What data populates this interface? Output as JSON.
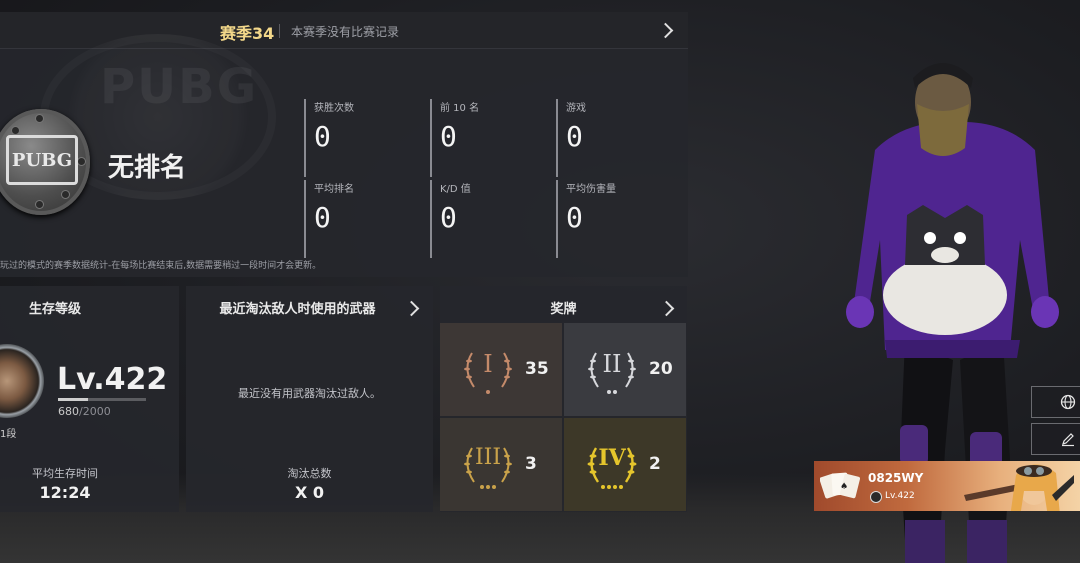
{
  "season": {
    "title": "赛季34",
    "note": "本赛季没有比赛记录",
    "rank_name": "无排名",
    "badge_text": "PUBG",
    "bg_logo_text": "PUBG",
    "stats": [
      {
        "label": "获胜次数",
        "value": "0"
      },
      {
        "label": "前 10 名",
        "value": "0"
      },
      {
        "label": "游戏",
        "value": "0"
      },
      {
        "label": "平均排名",
        "value": "0"
      },
      {
        "label": "K/D 值",
        "value": "0"
      },
      {
        "label": "平均伤害量",
        "value": "0"
      }
    ],
    "footnote": "玩过的模式的赛季数据统计-在每场比赛结束后,数据需要稍过一段时间才会更新。"
  },
  "survival": {
    "title": "生存等级",
    "level": "Lv.422",
    "xp_current": "680",
    "xp_total": "/2000",
    "xp_fraction": 0.34,
    "tier": "1段",
    "avg_time_label": "平均生存时间",
    "avg_time_value": "12:24"
  },
  "weapons": {
    "title": "最近淘汰敌人时使用的武器",
    "empty_text": "最近没有用武器淘汰过敌人。",
    "kills_label": "淘汰总数",
    "kills_value": "X 0"
  },
  "medals": {
    "title": "奖牌",
    "items": [
      {
        "numeral": "I",
        "count": "35",
        "color": "#c48a6a"
      },
      {
        "numeral": "II",
        "count": "20",
        "color": "#d7d8dc"
      },
      {
        "numeral": "III",
        "count": "3",
        "color": "#c9a24a"
      },
      {
        "numeral": "IV",
        "count": "2",
        "color": "#e5c52c"
      }
    ]
  },
  "player": {
    "name": "0825WY",
    "level": "Lv.422"
  },
  "side_buttons": {
    "globe": "globe-icon",
    "edit": "pencil-icon"
  }
}
